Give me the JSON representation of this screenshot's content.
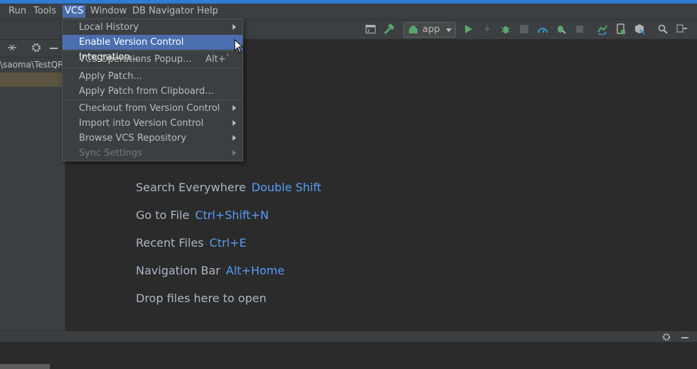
{
  "menubar": {
    "items": [
      {
        "label": "Run"
      },
      {
        "label": "Tools"
      },
      {
        "label": "VCS"
      },
      {
        "label": "Window"
      },
      {
        "label": "DB Navigator"
      },
      {
        "label": "Help"
      }
    ],
    "active": "VCS"
  },
  "toolbar": {
    "run_config": "app",
    "icons": [
      "terminal-icon",
      "build-hammer-icon",
      "run-icon",
      "flash-icon",
      "debug-icon",
      "coverage-icon",
      "profiler-icon",
      "attach-debugger-icon",
      "stop-icon",
      "sync-gradle-icon",
      "device-manager-icon",
      "sdk-manager-icon",
      "search-icon",
      "ellipsis-icon"
    ]
  },
  "sidebar": {
    "path": "\\saoma\\TestQR"
  },
  "vcs_menu": {
    "items": [
      {
        "label": "Local History",
        "shortcut": "",
        "submenu": true,
        "state": "normal"
      },
      {
        "label": "Enable Version Control Integration...",
        "shortcut": "",
        "submenu": false,
        "state": "selected"
      },
      {
        "label": "VCS Operations Popup...",
        "shortcut": "Alt+`",
        "submenu": false,
        "state": "normal"
      },
      {
        "label": "Apply Patch...",
        "shortcut": "",
        "submenu": false,
        "state": "normal"
      },
      {
        "label": "Apply Patch from Clipboard...",
        "shortcut": "",
        "submenu": false,
        "state": "normal"
      },
      {
        "label": "Checkout from Version Control",
        "shortcut": "",
        "submenu": true,
        "state": "normal"
      },
      {
        "label": "Import into Version Control",
        "shortcut": "",
        "submenu": true,
        "state": "normal"
      },
      {
        "label": "Browse VCS Repository",
        "shortcut": "",
        "submenu": true,
        "state": "normal"
      },
      {
        "label": "Sync Settings",
        "shortcut": "",
        "submenu": true,
        "state": "disabled"
      }
    ]
  },
  "editor_hints": [
    {
      "label": "Search Everywhere",
      "key": "Double Shift"
    },
    {
      "label": "Go to File",
      "key": "Ctrl+Shift+N"
    },
    {
      "label": "Recent Files",
      "key": "Ctrl+E"
    },
    {
      "label": "Navigation Bar",
      "key": "Alt+Home"
    },
    {
      "label": "Drop files here to open",
      "key": ""
    }
  ],
  "colors": {
    "accent": "#4b6eaf",
    "hint_key": "#589df6",
    "top_stripe": "#2f7bd6"
  }
}
